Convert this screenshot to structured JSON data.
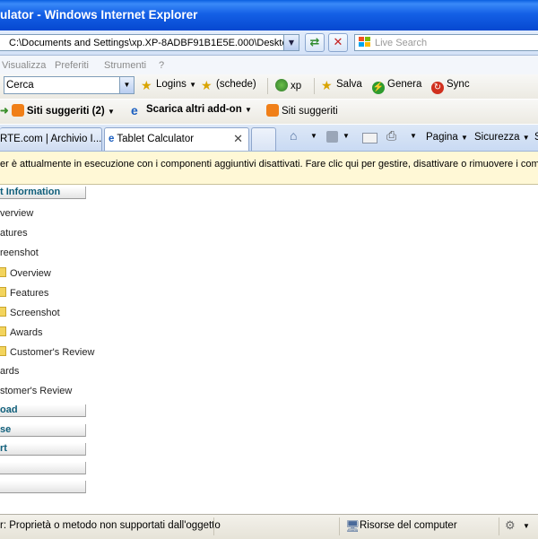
{
  "window": {
    "title": "ulator - Windows Internet Explorer"
  },
  "address_bar": {
    "url": "C:\\Documents and Settings\\xp.XP-8ADBF91B1E5E.000\\Desktop"
  },
  "search": {
    "placeholder": "Live Search"
  },
  "menu": {
    "items": [
      "Visualizza",
      "Preferiti",
      "Strumenti",
      "?"
    ]
  },
  "toolbar1": {
    "search_value": "Cerca",
    "items": [
      "Logins",
      "(schede)",
      "xp",
      "Salva",
      "Genera",
      "Sync"
    ]
  },
  "toolbar2": {
    "items": [
      "Siti suggeriti (2)",
      "Scarica altri add-on",
      "Siti suggeriti"
    ]
  },
  "tabs": [
    {
      "label": "RTE.com | Archivio I..."
    },
    {
      "label": "Tablet Calculator"
    }
  ],
  "command_bar": {
    "page": "Pagina",
    "security": "Sicurezza",
    "more": "S"
  },
  "infobar": {
    "text": "er è attualmente in esecuzione con i componenti aggiuntivi disattivati. Fare clic qui per gestire, disattivare o rimuovere i compo"
  },
  "sidebar": {
    "sections": [
      "t Information",
      "oad",
      "se",
      "rt",
      "",
      ""
    ],
    "items": [
      {
        "label": "verview",
        "folder": false
      },
      {
        "label": "atures",
        "folder": false
      },
      {
        "label": "reenshot",
        "folder": false
      },
      {
        "label": "Overview",
        "folder": true
      },
      {
        "label": "Features",
        "folder": true
      },
      {
        "label": "Screenshot",
        "folder": true
      },
      {
        "label": "Awards",
        "folder": true
      },
      {
        "label": "Customer's Review",
        "folder": true
      },
      {
        "label": "ards",
        "folder": false
      },
      {
        "label": "stomer's Review",
        "folder": false
      }
    ]
  },
  "status": {
    "left": "r: Proprietà o metodo non supportati dall'oggetto",
    "zone": "Risorse del computer"
  }
}
